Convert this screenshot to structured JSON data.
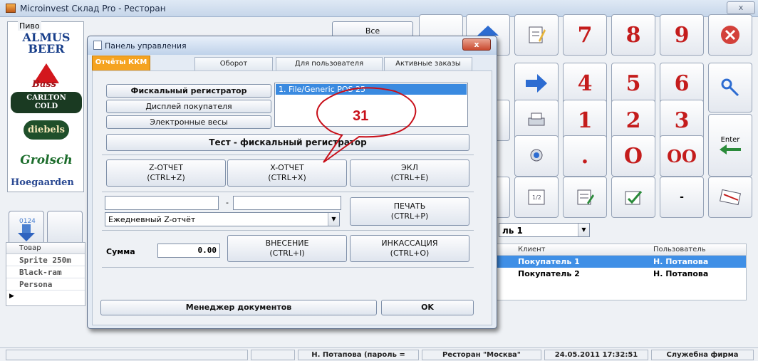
{
  "app": {
    "title": "Microinvest Склад Pro - Ресторан",
    "close_glyph": "x"
  },
  "beer_group": {
    "legend": "Пиво",
    "brands": [
      "ALMUS BEER",
      "Bass",
      "CARLTON COLD",
      "diebels",
      "Grolsch",
      "Hoegaarden"
    ],
    "all_label": "Все"
  },
  "goods_table": {
    "header": "Товар",
    "rows": [
      "Sprite 250m",
      "Black-ram",
      "Persona"
    ]
  },
  "keypad": {
    "digits": [
      "7",
      "8",
      "9",
      "4",
      "5",
      "6",
      "1",
      "2",
      "3",
      "O",
      "OO",
      "."
    ],
    "enter_label": "Enter"
  },
  "clients_panel": {
    "selector_value": "ль 1",
    "headers": {
      "client": "Клиент",
      "user": "Пользователь"
    },
    "rows": [
      {
        "client": "Покупатель 1",
        "user": "Н. Потапова",
        "selected": true
      },
      {
        "client": "Покупатель 2",
        "user": "Н. Потапова",
        "selected": false
      }
    ]
  },
  "status_bar": {
    "user": "Н. Потапова  (пароль =",
    "location": "Ресторан \"Москва\"",
    "datetime": "24.05.2011 17:32:51",
    "company": "Служебна фирма"
  },
  "dialog": {
    "title": "Панель управления",
    "close_glyph": "x",
    "tabs": [
      {
        "label": "Отчёты ККМ",
        "active": true
      },
      {
        "label": "Оборот",
        "active": false
      },
      {
        "label": "Для пользователя",
        "active": false
      },
      {
        "label": "Активные заказы",
        "active": false
      }
    ],
    "devices": {
      "fiscal": "Фискальный регистратор",
      "display": "Дисплей покупателя",
      "scales": "Электронные весы"
    },
    "device_list_item": "1.  File/Generic POS 25",
    "test_button": "Тест - фискальный регистратор",
    "z_report": {
      "line1": "Z-ОТЧЕТ",
      "line2": "(CTRL+Z)"
    },
    "x_report": {
      "line1": "X-ОТЧЕТ",
      "line2": "(CTRL+X)"
    },
    "ekl": {
      "line1": "ЭКЛ",
      "line2": "(CTRL+E)"
    },
    "range_dash": "-",
    "report_select": "Ежедневный Z-отчёт",
    "print": {
      "line1": "ПЕЧАТЬ",
      "line2": "(CTRL+P)"
    },
    "amount_label": "Сумма",
    "amount_value": "0.00",
    "deposit": {
      "line1": "ВНЕСЕНИЕ",
      "line2": "(CTRL+I)"
    },
    "collection": {
      "line1": "ИНКАССАЦИЯ",
      "line2": "(CTRL+O)"
    },
    "doc_manager": "Менеджер документов",
    "ok": "OK"
  },
  "annotation": {
    "number": "31",
    "color": "#c8101a"
  },
  "colors": {
    "active_tab": "#f5a320",
    "selection": "#3a8ae0",
    "digit_red": "#c41c1c"
  }
}
